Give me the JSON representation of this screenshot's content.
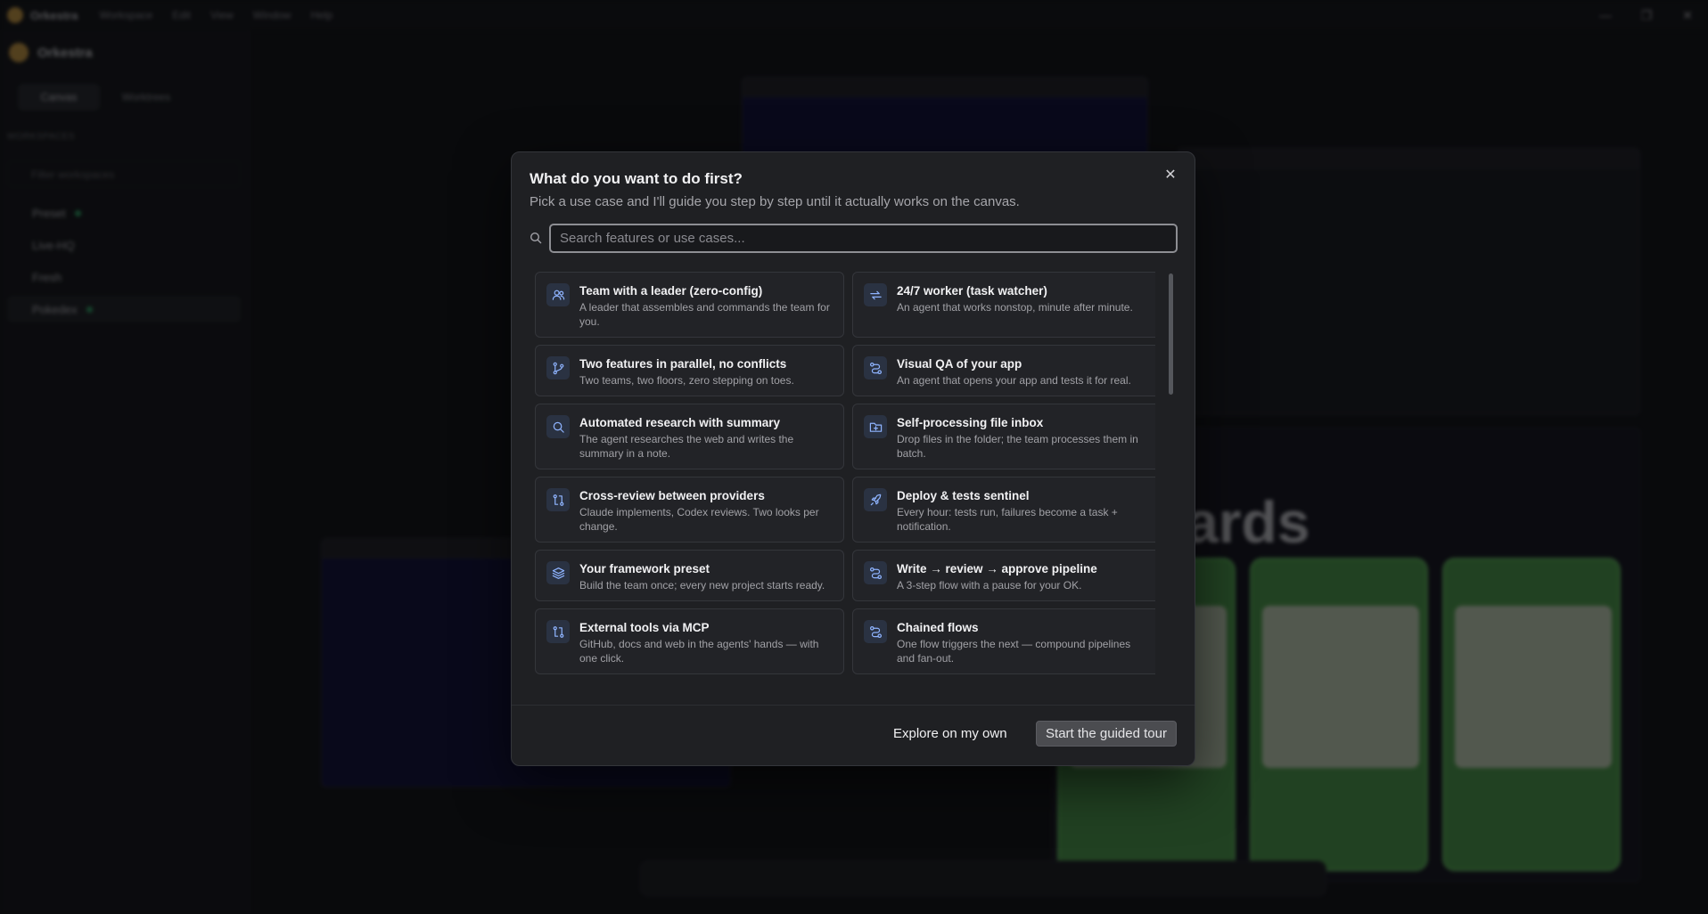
{
  "background": {
    "app_name": "Orkestra",
    "menu": [
      "Workspace",
      "Edit",
      "View",
      "Window",
      "Help"
    ],
    "sidebar_tabs": [
      "Canvas",
      "Worktrees"
    ],
    "section_label": "WORKSPACES",
    "filter_placeholder": "Filter workspaces",
    "workspaces": [
      {
        "name": "Preset",
        "active": false
      },
      {
        "name": "Live-HQ",
        "active": false
      },
      {
        "name": "Fresh",
        "active": false
      },
      {
        "name": "Pokedex",
        "active": true
      }
    ],
    "canvas_text": "ards"
  },
  "modal": {
    "title": "What do you want to do first?",
    "subtitle": "Pick a use case and I'll guide you step by step until it actually works on the canvas.",
    "search_placeholder": "Search features or use cases...",
    "close_icon": "close-icon",
    "cards": [
      {
        "icon": "users-icon",
        "title": "Team with a leader (zero-config)",
        "desc": "A leader that assembles and commands the team for you."
      },
      {
        "icon": "repeat-icon",
        "title": "24/7 worker (task watcher)",
        "desc": "An agent that works nonstop, minute after minute."
      },
      {
        "icon": "git-branch-icon",
        "title": "Two features in parallel, no conflicts",
        "desc": "Two teams, two floors, zero stepping on toes."
      },
      {
        "icon": "route-icon",
        "title": "Visual QA of your app",
        "desc": "An agent that opens your app and tests it for real."
      },
      {
        "icon": "search-icon",
        "title": "Automated research with summary",
        "desc": "The agent researches the web and writes the summary in a note."
      },
      {
        "icon": "folder-plus-icon",
        "title": "Self-processing file inbox",
        "desc": "Drop files in the folder; the team processes them in batch."
      },
      {
        "icon": "git-compare-icon",
        "title": "Cross-review between providers",
        "desc": "Claude implements, Codex reviews. Two looks per change."
      },
      {
        "icon": "rocket-icon",
        "title": "Deploy & tests sentinel",
        "desc": "Every hour: tests run, failures become a task + notification."
      },
      {
        "icon": "layers-icon",
        "title": "Your framework preset",
        "desc": "Build the team once; every new project starts ready."
      },
      {
        "icon": "route-icon",
        "title": "Write → review → approve pipeline",
        "desc": "A 3-step flow with a pause for your OK."
      },
      {
        "icon": "git-compare-icon",
        "title": "External tools via MCP",
        "desc": "GitHub, docs and web in the agents' hands — with one click."
      },
      {
        "icon": "route-icon",
        "title": "Chained flows",
        "desc": "One flow triggers the next — compound pipelines and fan-out."
      }
    ],
    "footer": {
      "explore_label": "Explore on my own",
      "tour_label": "Start the guided tour"
    }
  }
}
